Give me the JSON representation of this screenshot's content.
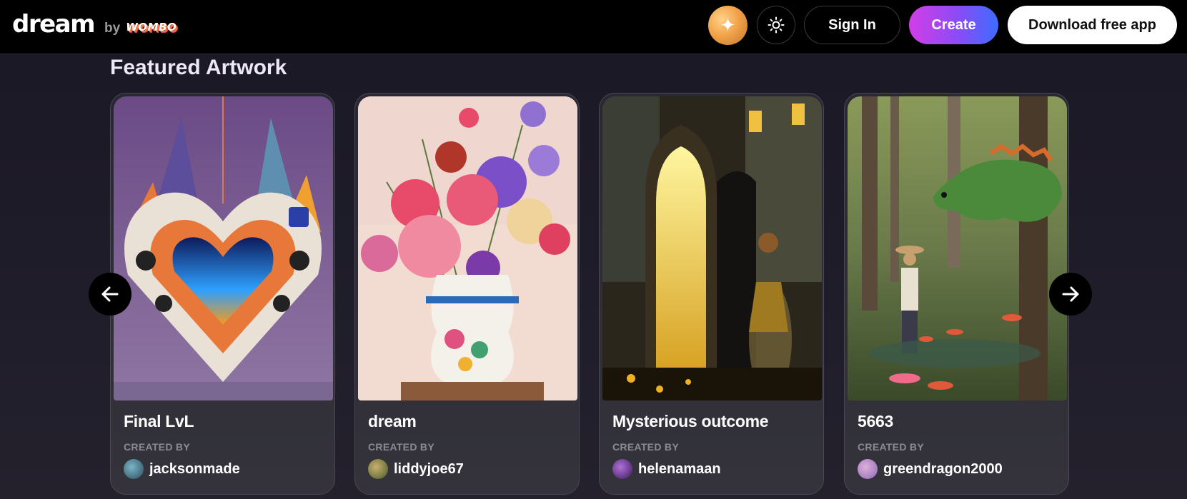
{
  "header": {
    "logo_text": "dream",
    "logo_by": "by",
    "logo_brand": "WOMBO",
    "sign_in_label": "Sign In",
    "create_label": "Create",
    "download_label": "Download free app"
  },
  "section": {
    "title": "Featured Artwork",
    "created_by_label": "CREATED BY"
  },
  "artworks": [
    {
      "title": "Final LvL",
      "author": "jacksonmade"
    },
    {
      "title": "dream",
      "author": "liddyjoe67"
    },
    {
      "title": "Mysterious outcome",
      "author": "helenamaan"
    },
    {
      "title": "5663",
      "author": "greendragon2000"
    }
  ],
  "colors": {
    "create_gradient_start": "#d33ee8",
    "create_gradient_end": "#3d6cff",
    "background": "#1e1b29"
  },
  "icons": {
    "theme": "sun-icon",
    "prev": "arrow-left-icon",
    "next": "arrow-right-icon",
    "profile": "sparkle-avatar-icon"
  }
}
